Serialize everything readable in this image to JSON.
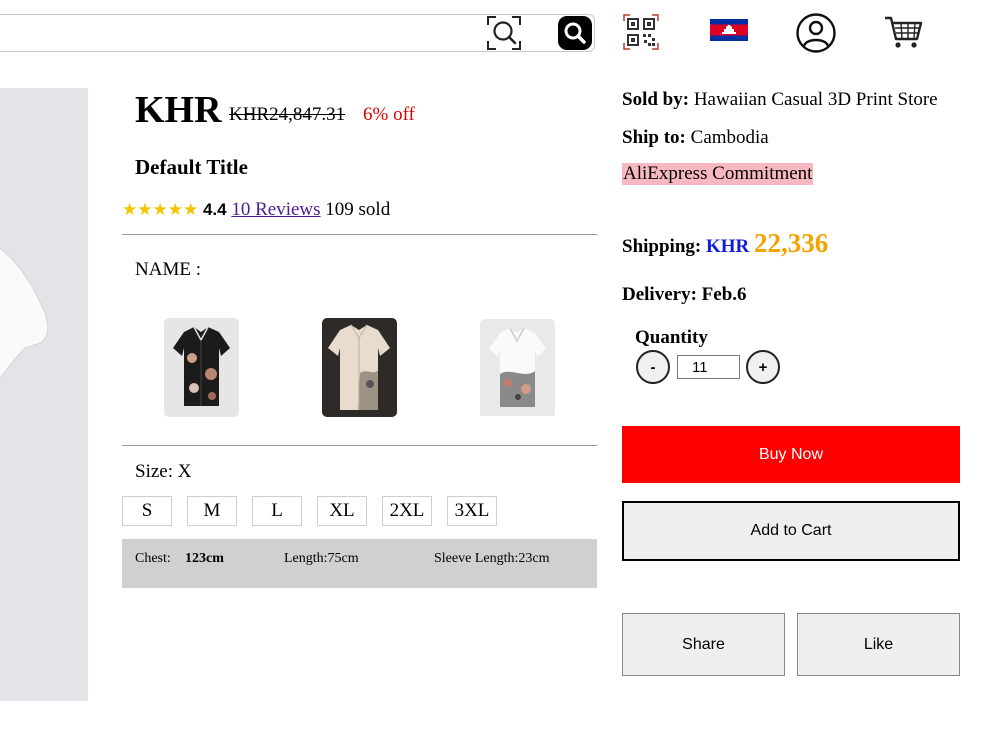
{
  "header": {
    "search_placeholder": "",
    "icons": [
      "scan-icon",
      "search-icon",
      "qr-code-icon",
      "cambodia-flag-icon",
      "user-icon",
      "cart-icon"
    ]
  },
  "product": {
    "price_currency": "KHR",
    "price_original": "KHR24,847.31",
    "discount": "6% off",
    "title": "Default Title",
    "stars": "★★★★★",
    "rating": "4.4",
    "reviews_link": "10 Reviews",
    "sold": "109 sold",
    "name_label": "NAME :",
    "size_label": "Size: X",
    "sizes": [
      "S",
      "M",
      "L",
      "XL",
      "2XL",
      "3XL"
    ],
    "measurements": {
      "chest_label": "Chest:",
      "chest_value": "123cm",
      "length": "Length:75cm",
      "sleeve": "Sleeve Length:23cm"
    }
  },
  "seller": {
    "sold_by_label": "Sold by:",
    "sold_by_value": "Hawaiian Casual 3D Print Store",
    "ship_to_label": "Ship to:",
    "ship_to_value": "Cambodia",
    "commitment": "AliExpress Commitment",
    "shipping_label": "Shipping:",
    "shipping_currency": "KHR",
    "shipping_amount": "22,336",
    "delivery": "Delivery: Feb.6"
  },
  "purchase": {
    "quantity_label": "Quantity",
    "minus": "-",
    "plus": "+",
    "quantity_value": "11",
    "buy_now": "Buy Now",
    "add_to_cart": "Add to Cart",
    "share": "Share",
    "like": "Like"
  },
  "colors": {
    "discount": "#e00000",
    "buy_now_bg": "#ff0000",
    "shipping_currency": "#0f1ed6",
    "shipping_amount": "#f4a300",
    "commitment_bg": "#f7b8c2",
    "stars": "#f4c400"
  }
}
